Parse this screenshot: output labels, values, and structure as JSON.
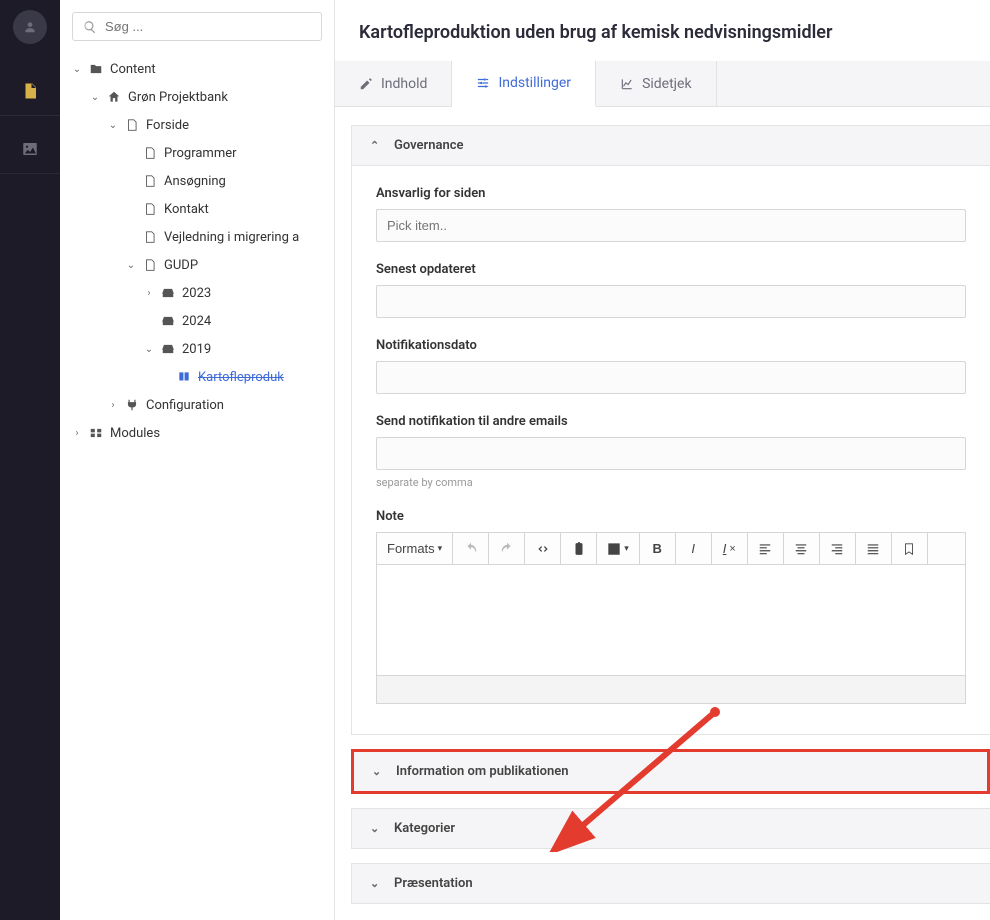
{
  "search": {
    "placeholder": "Søg ..."
  },
  "tree": {
    "content": "Content",
    "projektbank": "Grøn Projektbank",
    "forside": "Forside",
    "programmer": "Programmer",
    "ansogning": "Ansøgning",
    "kontakt": "Kontakt",
    "vejledning": "Vejledning i migrering a",
    "gudp": "GUDP",
    "y2023": "2023",
    "y2024": "2024",
    "y2019": "2019",
    "kartofle": "Kartofleproduk",
    "configuration": "Configuration",
    "modules": "Modules"
  },
  "page": {
    "title": "Kartofleproduktion uden brug af kemisk nedvisningsmidler"
  },
  "tabs": {
    "indhold": "Indhold",
    "indstillinger": "Indstillinger",
    "sidetjek": "Sidetjek"
  },
  "panels": {
    "governance": "Governance",
    "info_pub": "Information om publikationen",
    "kategorier": "Kategorier",
    "praesentation": "Præsentation"
  },
  "fields": {
    "ansvarlig_label": "Ansvarlig for siden",
    "ansvarlig_placeholder": "Pick item..",
    "senest_label": "Senest opdateret",
    "notif_dato_label": "Notifikationsdato",
    "send_notif_label": "Send notifikation til andre emails",
    "send_notif_hint": "separate by comma",
    "note_label": "Note"
  },
  "rte": {
    "formats": "Formats"
  }
}
